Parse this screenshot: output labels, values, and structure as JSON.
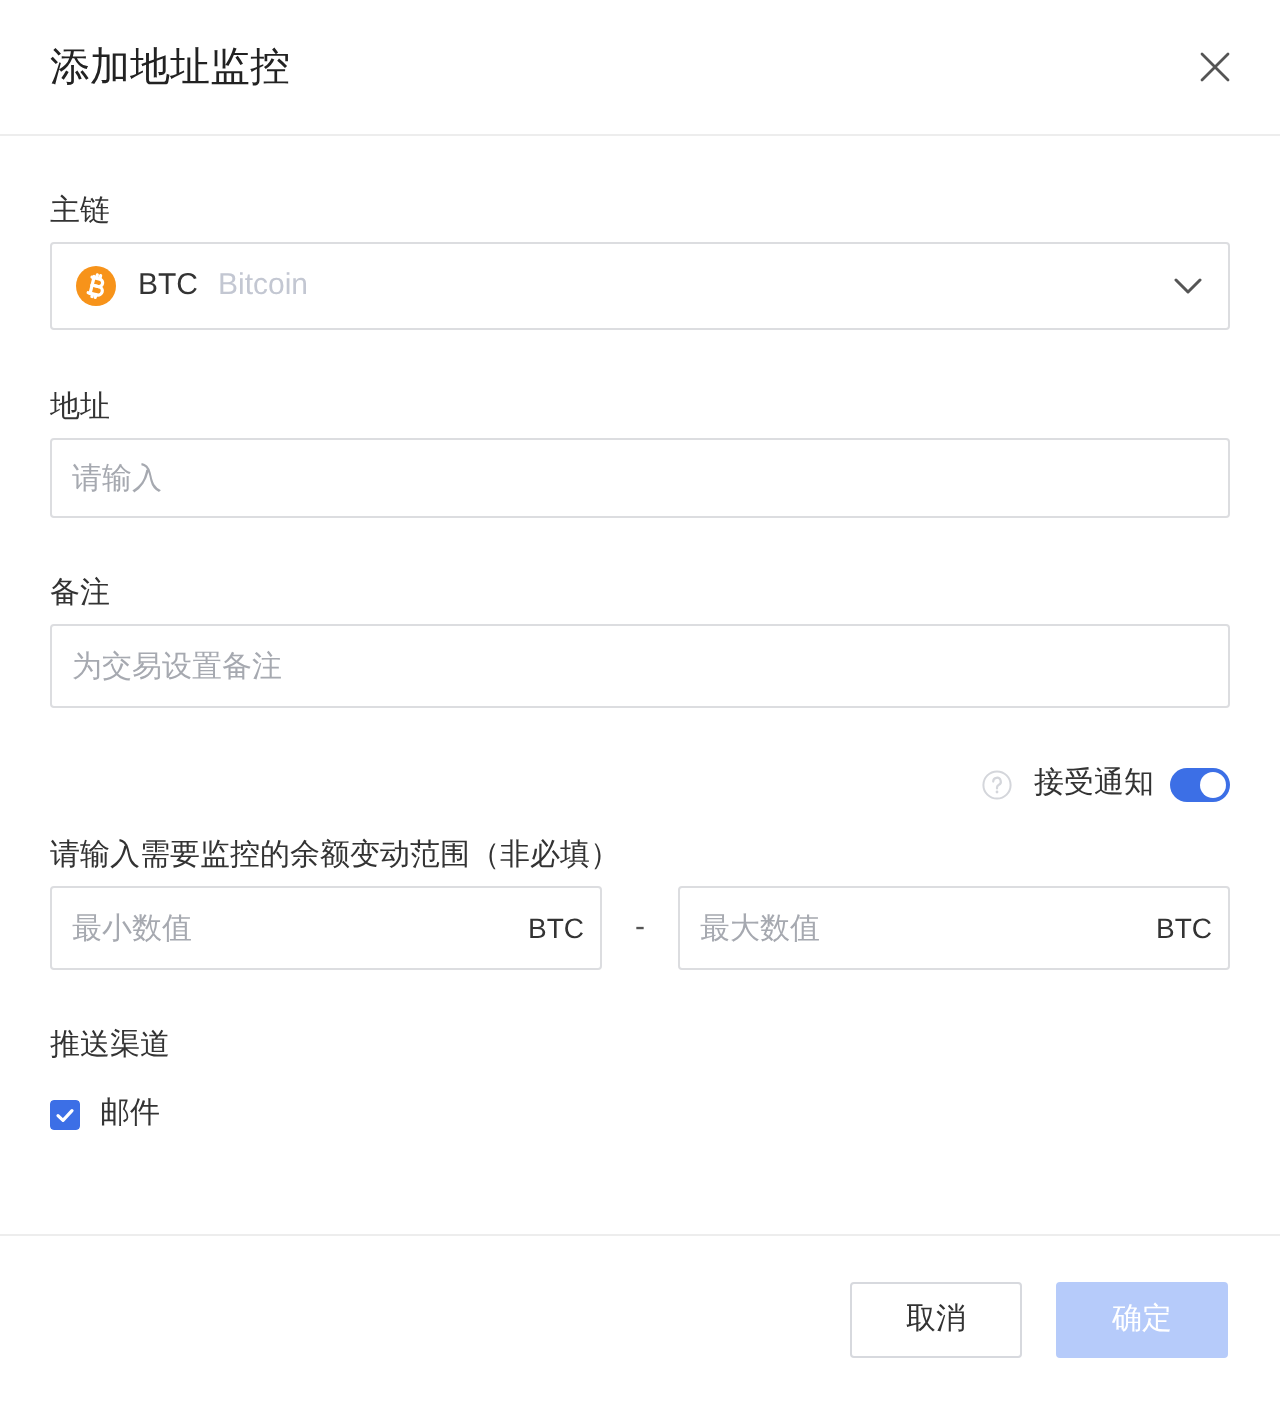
{
  "dialog": {
    "title": "添加地址监控"
  },
  "chain": {
    "label": "主链",
    "value": "BTC",
    "name": "Bitcoin"
  },
  "address": {
    "label": "地址",
    "placeholder": "请输入"
  },
  "note": {
    "label": "备注",
    "placeholder": "为交易设置备注"
  },
  "notify": {
    "label": "接受通知",
    "on": true
  },
  "range": {
    "label": "请输入需要监控的余额变动范围（非必填）",
    "min": {
      "placeholder": "最小数值",
      "unit": "BTC"
    },
    "separator": "-",
    "max": {
      "placeholder": "最大数值",
      "unit": "BTC"
    }
  },
  "channels": {
    "label": "推送渠道",
    "options": [
      {
        "label": "邮件",
        "checked": true
      }
    ]
  },
  "buttons": [
    {
      "label": "取消",
      "kind": "secondary",
      "disabled": false
    },
    {
      "label": "确定",
      "kind": "primary",
      "disabled": true
    }
  ]
}
